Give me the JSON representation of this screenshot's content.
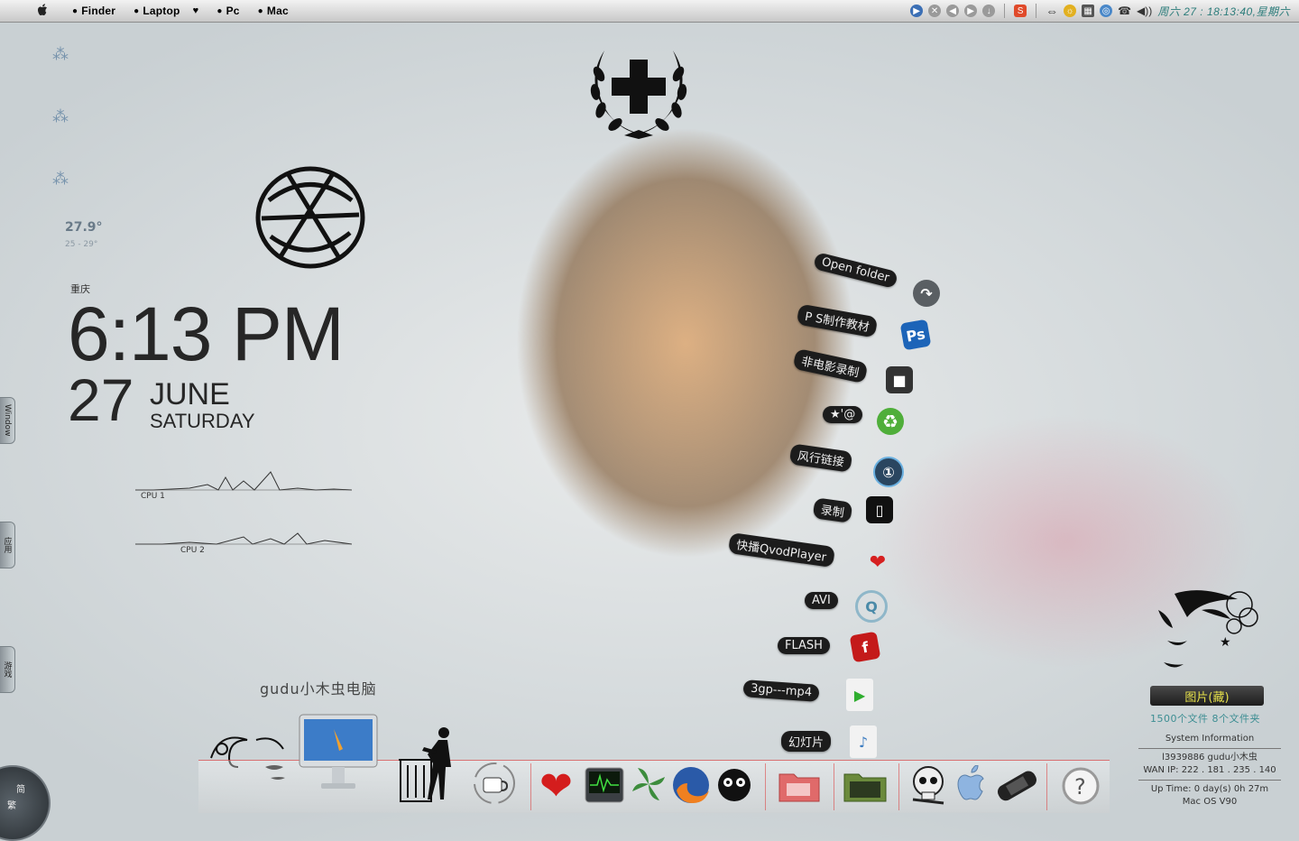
{
  "menubar": {
    "apple_icon": "apple-icon",
    "items": [
      "Finder",
      "Laptop",
      "Pc",
      "Mac"
    ],
    "laptop_heart": "♥",
    "tray_s_label": "S",
    "clock": "周六 27 : 18:13:40,星期六"
  },
  "weather": {
    "temperature": "27.9°",
    "range": "25 - 29°",
    "city": "重庆"
  },
  "clock": {
    "time": "6:13 PM",
    "day": "27",
    "month": "JUNE",
    "weekday": "SATURDAY"
  },
  "cpu": {
    "cpu1_label": "CPU 1",
    "cpu2_label": "CPU 2"
  },
  "side_tabs": [
    "Window",
    "应用",
    "游戏"
  ],
  "computer_label": "gudu小木虫电脑",
  "shortcuts": [
    {
      "label": "Open  folder",
      "icon": "forward-arrow-icon"
    },
    {
      "label": "P S制作教材",
      "icon": "photoshop-icon",
      "icon_text": "Ps"
    },
    {
      "label": "非电影录制",
      "icon": "camcorder-icon"
    },
    {
      "label": "★'@",
      "icon": "recycle-icon"
    },
    {
      "label": "风行链接",
      "icon": "fengxing-icon"
    },
    {
      "label": "录制",
      "icon": "phone-icon"
    },
    {
      "label": "快播QvodPlayer",
      "icon": "heart-icon"
    },
    {
      "label": "AVI",
      "icon": "quicktime-icon"
    },
    {
      "label": "FLASH",
      "icon": "flash-icon"
    },
    {
      "label": "3gp---mp4",
      "icon": "play-file-icon"
    },
    {
      "label": "幻灯片",
      "icon": "music-file-icon"
    }
  ],
  "photo_widget": {
    "title": "图片(藏)",
    "count": "1500个文件  8个文件夹"
  },
  "system_info": {
    "title": "System Information",
    "user": "l3939886  gudu小木虫",
    "wan_ip": "WAN IP: 222 . 181 . 235 . 140",
    "uptime": "Up Time: 0 day(s) 0h 27m",
    "os": "Mac OS  V90"
  },
  "corner": {
    "label_top": "简",
    "label_bottom": "繁"
  },
  "colors": {
    "accent": "#2b7c7a",
    "dock_border": "#dc3c3c"
  }
}
